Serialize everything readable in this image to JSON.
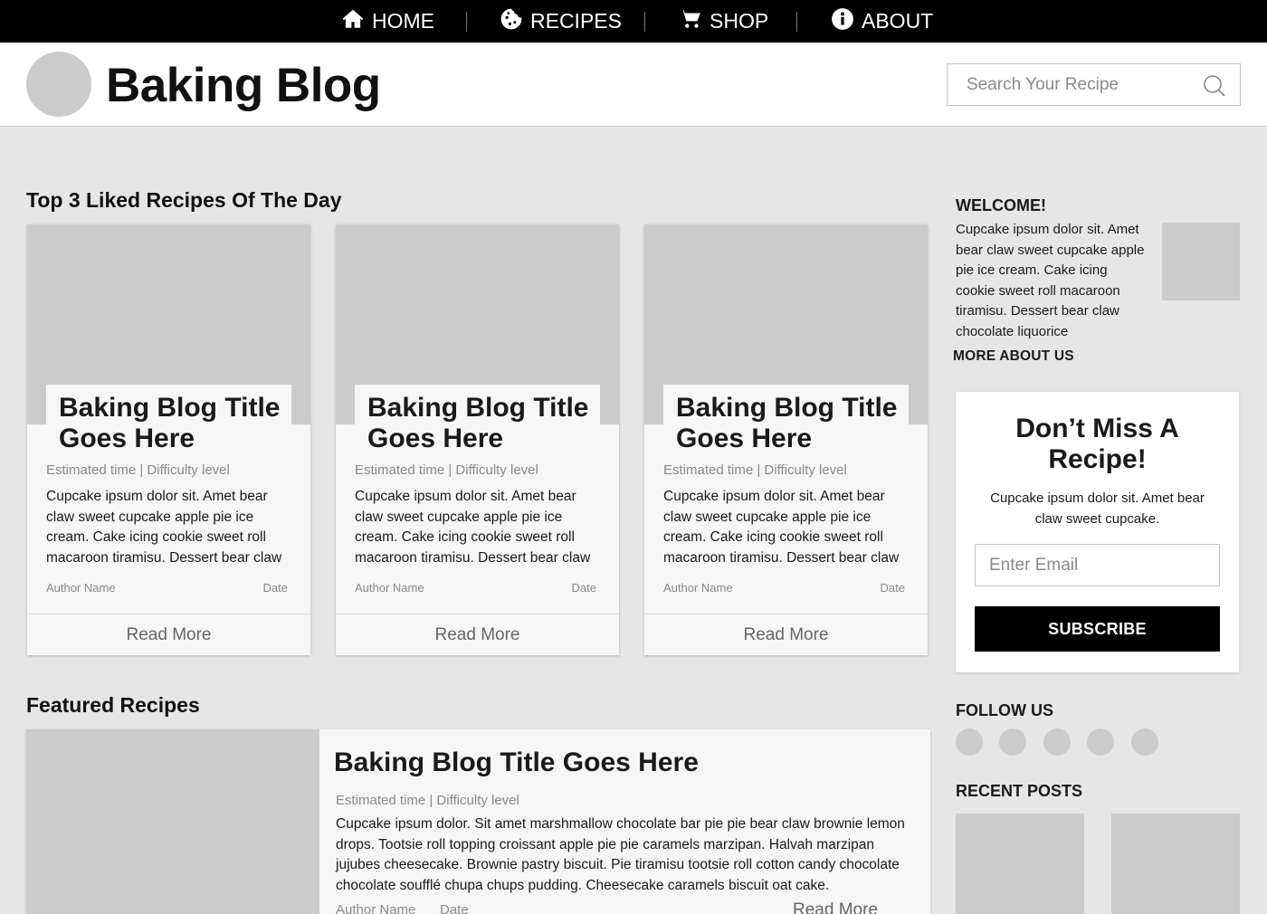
{
  "nav": {
    "items": [
      {
        "label": "HOME",
        "icon": "home-icon"
      },
      {
        "label": "RECIPES",
        "icon": "cookie-icon"
      },
      {
        "label": "SHOP",
        "icon": "cart-icon"
      },
      {
        "label": "ABOUT",
        "icon": "info-icon"
      }
    ]
  },
  "header": {
    "site_title": "Baking Blog",
    "search_placeholder": "Search Your Recipe"
  },
  "top_recipes": {
    "heading": "Top 3 Liked Recipes Of The Day",
    "cards": [
      {
        "title": "Baking Blog Title Goes Here",
        "meta": "Estimated time | Difficulty level",
        "excerpt": "Cupcake ipsum dolor sit. Amet bear claw sweet cupcake apple pie ice cream. Cake icing cookie sweet roll macaroon tiramisu. Dessert bear claw",
        "author": "Author Name",
        "date": "Date",
        "read_more": "Read More"
      },
      {
        "title": "Baking Blog Title Goes Here",
        "meta": "Estimated time | Difficulty level",
        "excerpt": "Cupcake ipsum dolor sit. Amet bear claw sweet cupcake apple pie ice cream. Cake icing cookie sweet roll macaroon tiramisu. Dessert bear claw",
        "author": "Author Name",
        "date": "Date",
        "read_more": "Read More"
      },
      {
        "title": "Baking Blog Title Goes Here",
        "meta": "Estimated time | Difficulty level",
        "excerpt": "Cupcake ipsum dolor sit. Amet bear claw sweet cupcake apple pie ice cream. Cake icing cookie sweet roll macaroon tiramisu. Dessert bear claw",
        "author": "Author Name",
        "date": "Date",
        "read_more": "Read More"
      }
    ]
  },
  "featured": {
    "heading": "Featured Recipes",
    "title": "Baking Blog Title Goes Here",
    "meta": "Estimated time | Difficulty level",
    "excerpt": "Cupcake ipsum dolor. Sit amet marshmallow chocolate bar pie pie bear claw brownie lemon drops. Tootsie roll topping croissant apple pie pie caramels marzipan. Halvah marzipan jujubes cheesecake. Brownie pastry biscuit. Pie tiramisu tootsie roll cotton candy chocolate chocolate soufflé chupa chups pudding. Cheesecake caramels biscuit oat cake.",
    "author": "Author Name",
    "date": "Date",
    "read_more": "Read More"
  },
  "sidebar": {
    "welcome": {
      "heading": "WELCOME!",
      "text": "Cupcake ipsum dolor sit. Amet bear claw sweet cupcake apple pie ice cream. Cake icing cookie sweet roll macaroon tiramisu. Dessert bear claw chocolate liquorice",
      "link": "MORE ABOUT US"
    },
    "newsletter": {
      "title": "Don’t Miss A Recipe!",
      "text": "Cupcake ipsum dolor sit. Amet bear claw sweet cupcake.",
      "email_placeholder": "Enter Email",
      "button_label": "SUBSCRIBE"
    },
    "follow_heading": "FOLLOW US",
    "recent_heading": "RECENT POSTS"
  }
}
